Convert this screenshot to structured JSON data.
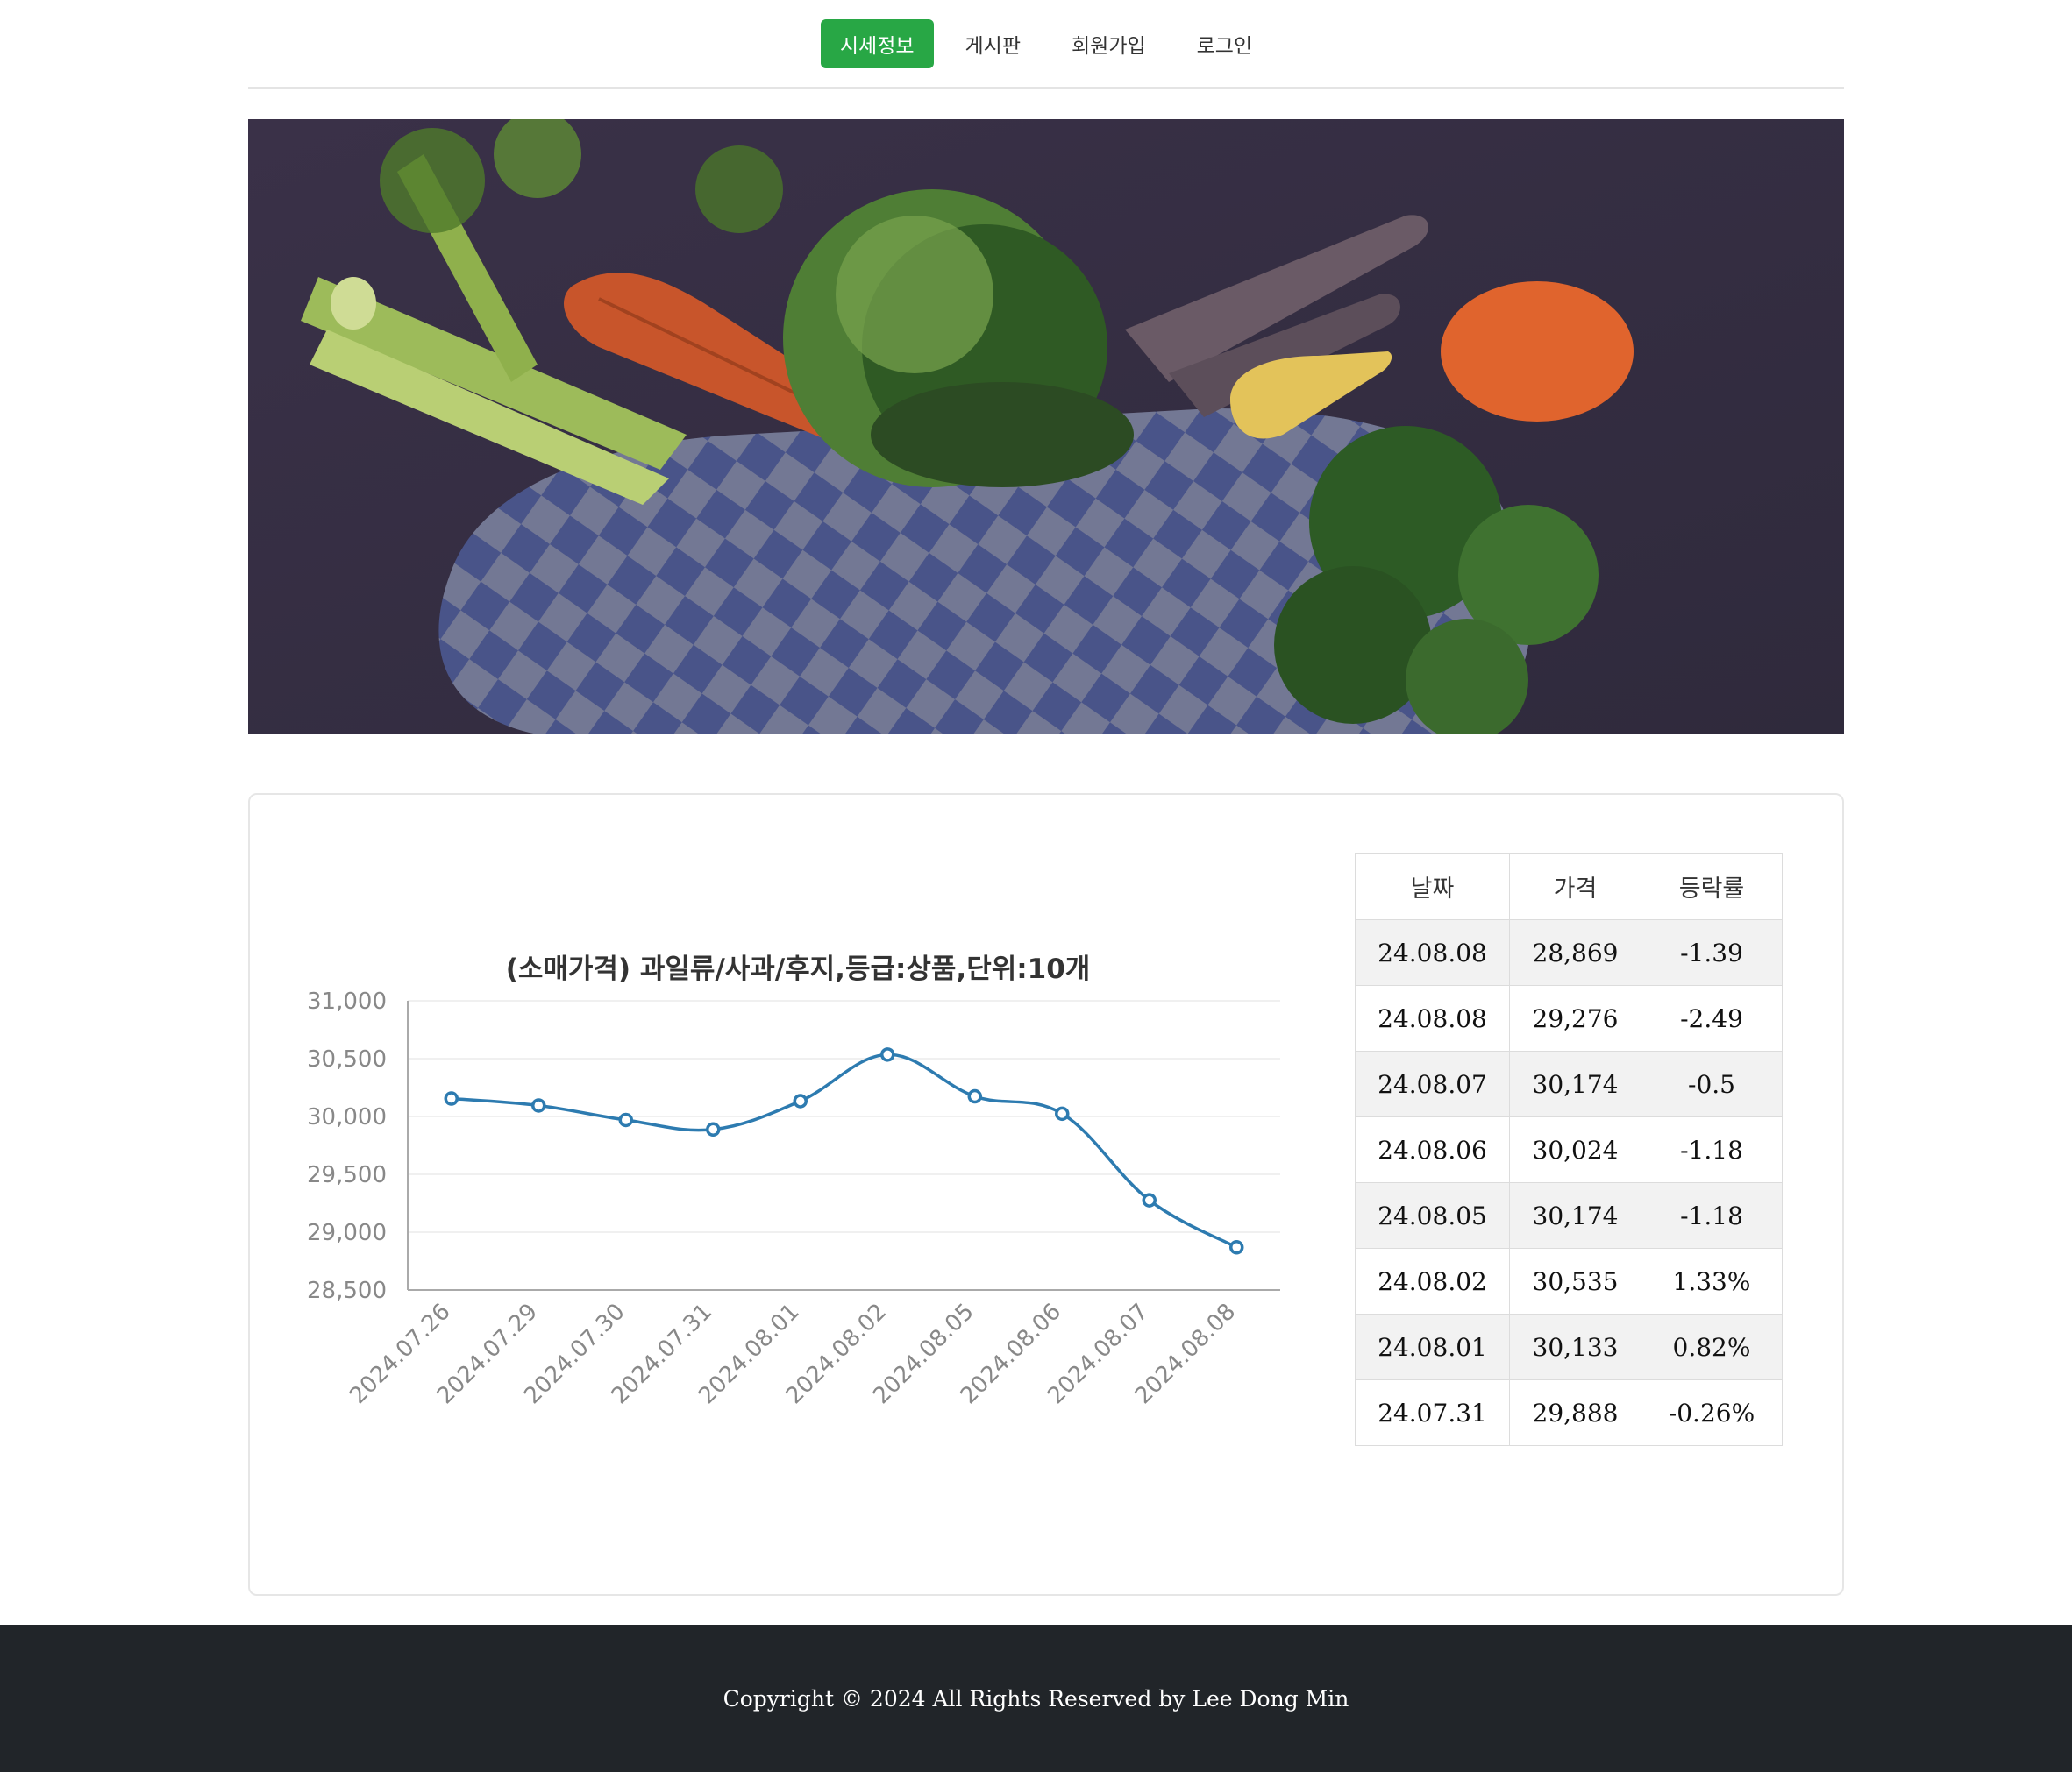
{
  "nav": {
    "items": [
      {
        "label": "시세정보",
        "active": true
      },
      {
        "label": "게시판",
        "active": false
      },
      {
        "label": "회원가입",
        "active": false
      },
      {
        "label": "로그인",
        "active": false
      }
    ]
  },
  "hero": {
    "image": "vegetables-basket-photo"
  },
  "chart_data": {
    "type": "line",
    "title": "(소매가격) 과일류/사과/후지,등급:상품,단위:10개",
    "x": [
      "2024.07.26",
      "2024.07.29",
      "2024.07.30",
      "2024.07.31",
      "2024.08.01",
      "2024.08.02",
      "2024.08.05",
      "2024.08.06",
      "2024.08.07",
      "2024.08.08"
    ],
    "series": [
      {
        "values": [
          30155,
          30095,
          29970,
          29888,
          30133,
          30535,
          30174,
          30024,
          29276,
          28869
        ],
        "color": "#2d7bb0"
      }
    ],
    "ylim": [
      28500,
      31000
    ],
    "yticks": [
      "31,000",
      "30,500",
      "30,000",
      "29,500",
      "29,000",
      "28,500"
    ],
    "grid": true
  },
  "table": {
    "headers": [
      "날짜",
      "가격",
      "등락률"
    ],
    "rows": [
      [
        "24.08.08",
        "28,869",
        "-1.39"
      ],
      [
        "24.08.08",
        "29,276",
        "-2.49"
      ],
      [
        "24.08.07",
        "30,174",
        "-0.5"
      ],
      [
        "24.08.06",
        "30,024",
        "-1.18"
      ],
      [
        "24.08.05",
        "30,174",
        "-1.18"
      ],
      [
        "24.08.02",
        "30,535",
        "1.33%"
      ],
      [
        "24.08.01",
        "30,133",
        "0.82%"
      ],
      [
        "24.07.31",
        "29,888",
        "-0.26%"
      ]
    ]
  },
  "footer": {
    "text": "Copyright © 2024 All Rights Reserved by Lee Dong Min"
  }
}
